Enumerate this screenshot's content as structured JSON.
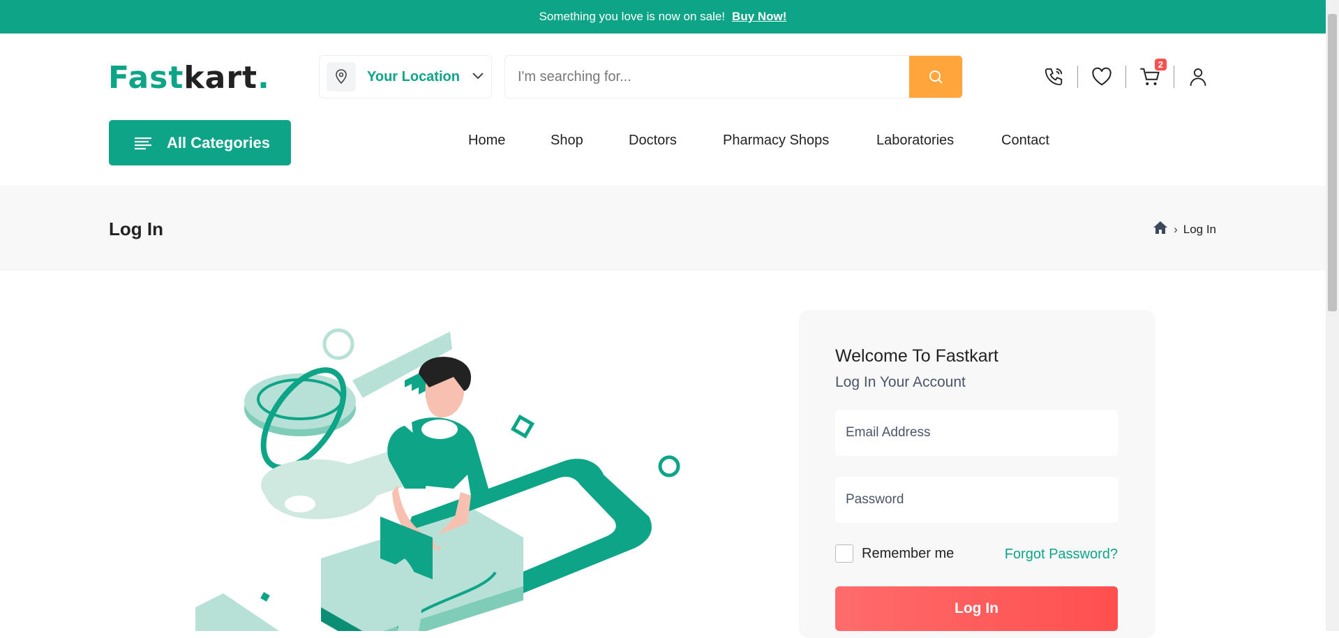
{
  "topbar": {
    "message": "Something you love is now on sale!",
    "link": "Buy Now!"
  },
  "logo": {
    "part1": "Fast",
    "part2": "kart",
    "dot": "."
  },
  "location": {
    "label": "Your Location",
    "icon": "map-pin-icon"
  },
  "search": {
    "placeholder": "I'm searching for...",
    "icon": "search-icon"
  },
  "header_icons": {
    "cart_count": "2"
  },
  "categories": {
    "label": "All Categories"
  },
  "nav": [
    "Home",
    "Shop",
    "Doctors",
    "Pharmacy Shops",
    "Laboratories",
    "Contact"
  ],
  "breadcrumb": {
    "title": "Log In",
    "current": "Log In",
    "separator": "›"
  },
  "login": {
    "heading": "Welcome To Fastkart",
    "subheading": "Log In Your Account",
    "email_placeholder": "Email Address",
    "password_placeholder": "Password",
    "remember": "Remember me",
    "forgot": "Forgot Password?",
    "button": "Log In"
  },
  "colors": {
    "brand": "#0da487",
    "search_button": "#ffa53b",
    "login_button": "#ff4f4f",
    "badge": "#ff4f4f"
  }
}
